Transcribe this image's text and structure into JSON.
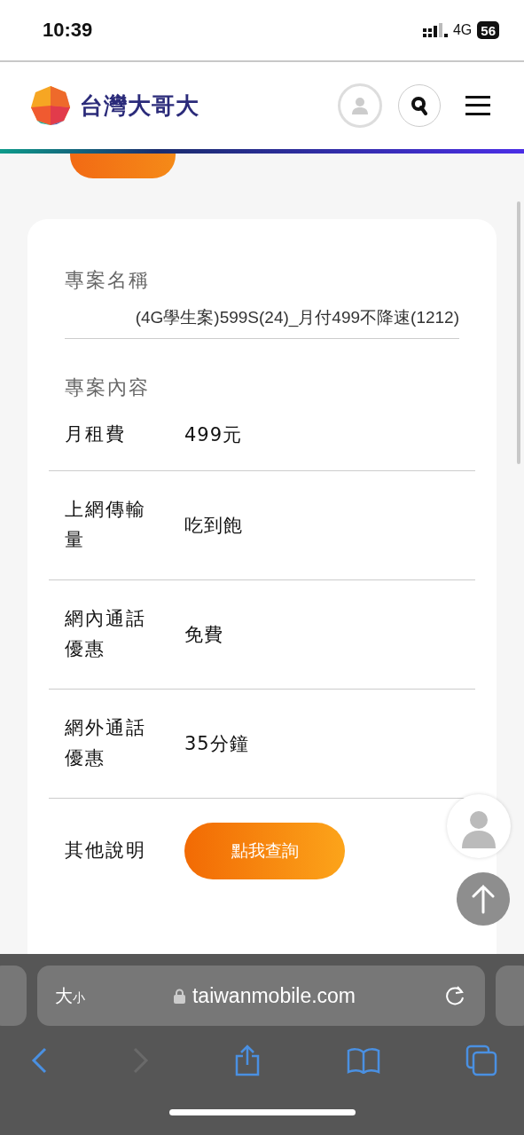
{
  "status_bar": {
    "time": "10:39",
    "network": "4G",
    "battery": "56"
  },
  "header": {
    "brand": "台灣大哥大"
  },
  "plan": {
    "name_label": "專案名稱",
    "name_value": "(4G學生案)599S(24)_月付499不降速(1212)",
    "content_label": "專案內容",
    "rows": [
      {
        "kind": "text",
        "label": "月租費",
        "value": "499元"
      },
      {
        "kind": "text",
        "label": "上網傳輸量",
        "value": "吃到飽"
      },
      {
        "kind": "text",
        "label": "網內通話優惠",
        "value": "免費"
      },
      {
        "kind": "text",
        "label": "網外通話優惠",
        "value": "35分鐘"
      },
      {
        "kind": "button",
        "label": "其他說明",
        "value": "點我查詢"
      }
    ]
  },
  "browser": {
    "text_size_large": "大",
    "text_size_small": "小",
    "url": "taiwanmobile.com"
  }
}
